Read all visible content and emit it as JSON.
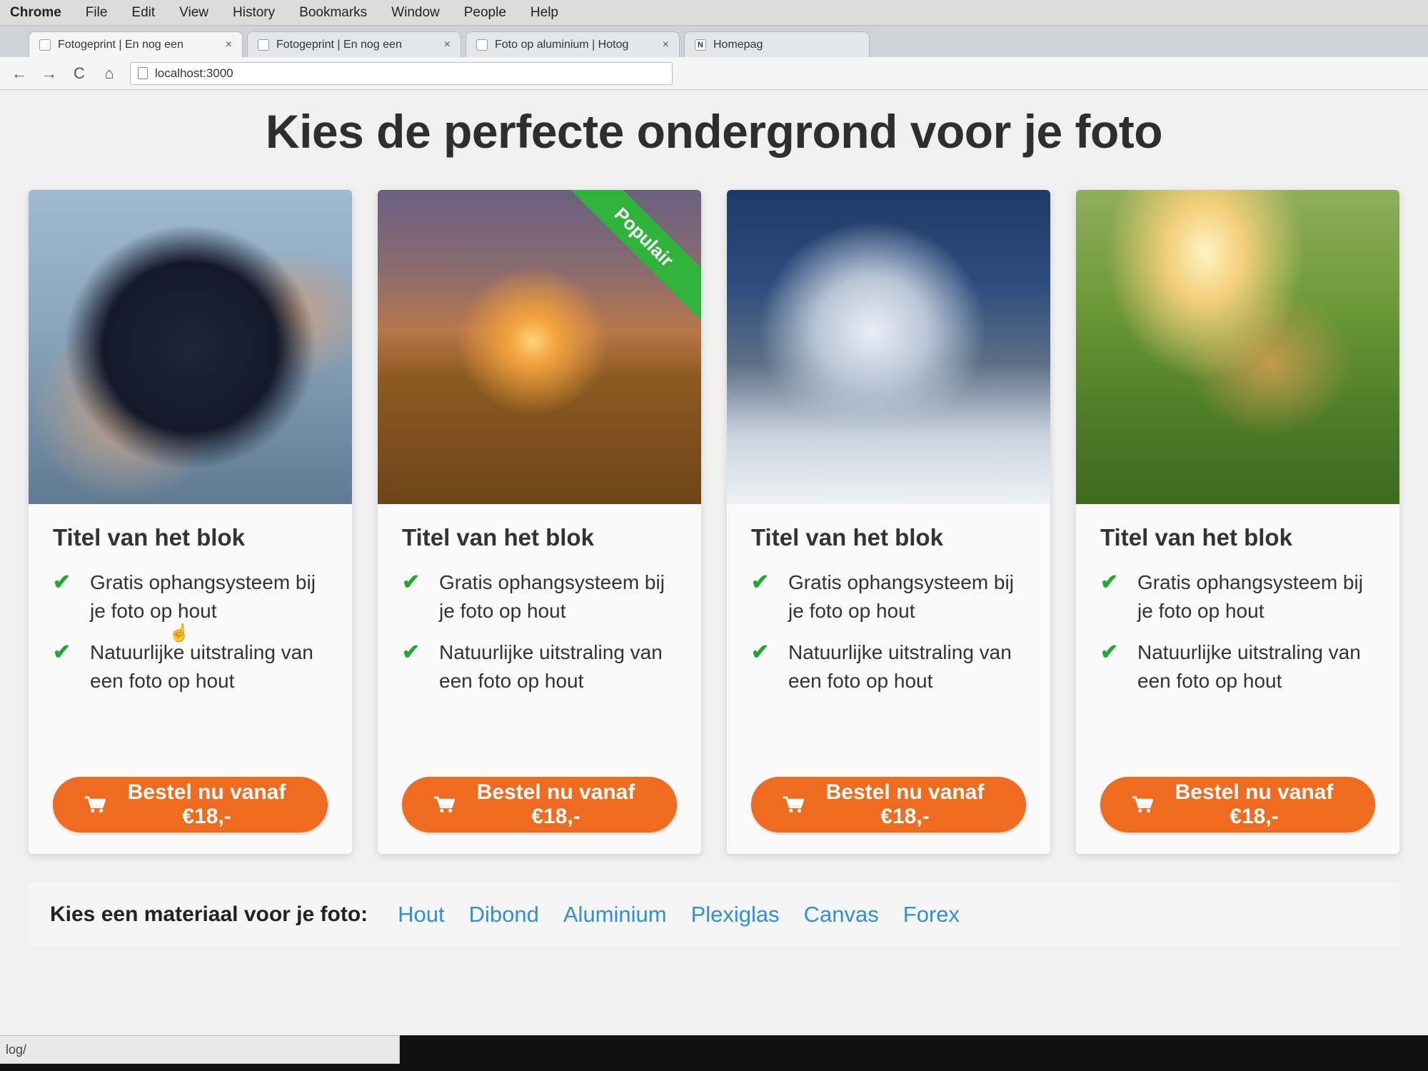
{
  "menubar": {
    "app": "Chrome",
    "items": [
      "File",
      "Edit",
      "View",
      "History",
      "Bookmarks",
      "Window",
      "People",
      "Help"
    ]
  },
  "tabs": [
    {
      "title": "Fotogeprint | En nog een",
      "close": "×"
    },
    {
      "title": "Fotogeprint | En nog een",
      "close": "×"
    },
    {
      "title": "Foto op aluminium | Hotog",
      "close": "×"
    },
    {
      "title": "Homepag",
      "favicon": "N",
      "close": ""
    }
  ],
  "toolbar": {
    "back": "←",
    "forward": "→",
    "reload": "C",
    "home": "⌂",
    "url": "localhost:3000"
  },
  "page": {
    "headline": "Kies de perfecte ondergrond voor je foto",
    "cards": [
      {
        "image": "grapes-in-hands",
        "title": "Titel van het blok",
        "features": [
          "Gratis ophangsysteem bij je foto op hout",
          "Natuurlijke uitstraling van een foto op hout"
        ],
        "button": "Bestel nu vanaf €18,-",
        "badge": ""
      },
      {
        "image": "sunset-field",
        "title": "Titel van het blok",
        "features": [
          "Gratis ophangsysteem bij je foto op hout",
          "Natuurlijke uitstraling van een foto op hout"
        ],
        "button": "Bestel nu vanaf €18,-",
        "badge": "Populair"
      },
      {
        "image": "snowy-mountain",
        "title": "Titel van het blok",
        "features": [
          "Gratis ophangsysteem bij je foto op hout",
          "Natuurlijke uitstraling van een foto op hout"
        ],
        "button": "Bestel nu vanaf €18,-",
        "badge": ""
      },
      {
        "image": "girl-in-sunny-meadow",
        "title": "Titel van het blok",
        "features": [
          "Gratis ophangsysteem bij je foto op hout",
          "Natuurlijke uitstraling van een foto op hout"
        ],
        "button": "Bestel nu vanaf €18,-",
        "badge": ""
      }
    ],
    "material_label": "Kies een materiaal voor je foto:",
    "materials": [
      "Hout",
      "Dibond",
      "Aluminium",
      "Plexiglas",
      "Canvas",
      "Forex"
    ]
  },
  "statusbar": "log/",
  "icons": {
    "check": "check-icon",
    "cart": "cart-icon",
    "cursor": "hand-cursor-icon"
  },
  "colors": {
    "accent_orange": "#ef6b1f",
    "ribbon_green": "#2fb33a",
    "check_green": "#21a82e",
    "link_blue": "#2f8fd8"
  }
}
